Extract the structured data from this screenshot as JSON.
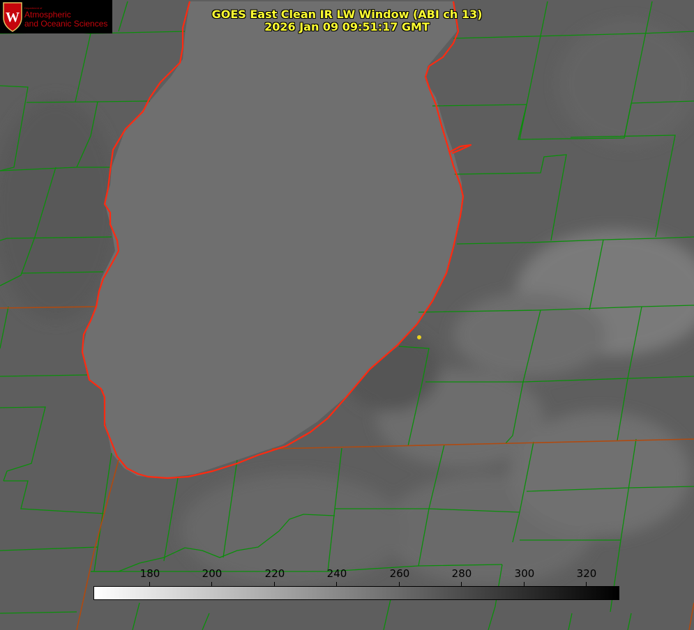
{
  "title": {
    "line1": "GOES East Clean IR LW Window (ABI ch 13)",
    "line2": "2026 Jan 09 09:51:17 GMT"
  },
  "logo": {
    "small": "Department of",
    "line1": "Atmospheric",
    "line2": "and Oceanic Sciences",
    "crest_letter": "W"
  },
  "colorbar": {
    "ticks": [
      "180",
      "200",
      "220",
      "240",
      "260",
      "280",
      "300",
      "320"
    ],
    "colors": {
      "low": "#ffffff",
      "high": "#000000"
    }
  },
  "colors": {
    "county_lines": "#0a8f0a",
    "coastline": "#ff2a10",
    "state_lines": "#b04a10",
    "title_text": "#ffff33",
    "station_dot": "#e8d020"
  }
}
